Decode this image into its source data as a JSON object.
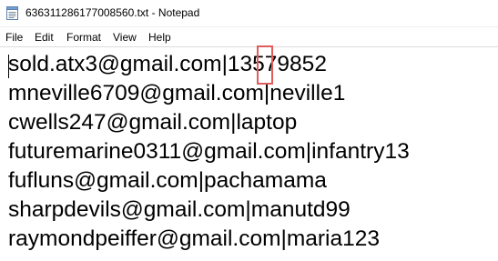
{
  "window": {
    "title": "636311286177008560.txt - Notepad"
  },
  "menu": {
    "items": [
      "File",
      "Edit",
      "Format",
      "View",
      "Help"
    ]
  },
  "document": {
    "lines": [
      "sold.atx3@gmail.com|13579852",
      "mneville6709@gmail.com|neville1",
      "cwells247@gmail.com|laptop",
      "futuremarine0311@gmail.com|infantry13",
      "fufluns@gmail.com|pachamama",
      "sharpdevils@gmail.com|manutd99",
      "raymondpeiffer@gmail.com|maria123"
    ]
  },
  "icons": {
    "app": "notepad-icon"
  },
  "colors": {
    "highlight": "#e15b5b",
    "text": "#000000",
    "background": "#ffffff"
  }
}
